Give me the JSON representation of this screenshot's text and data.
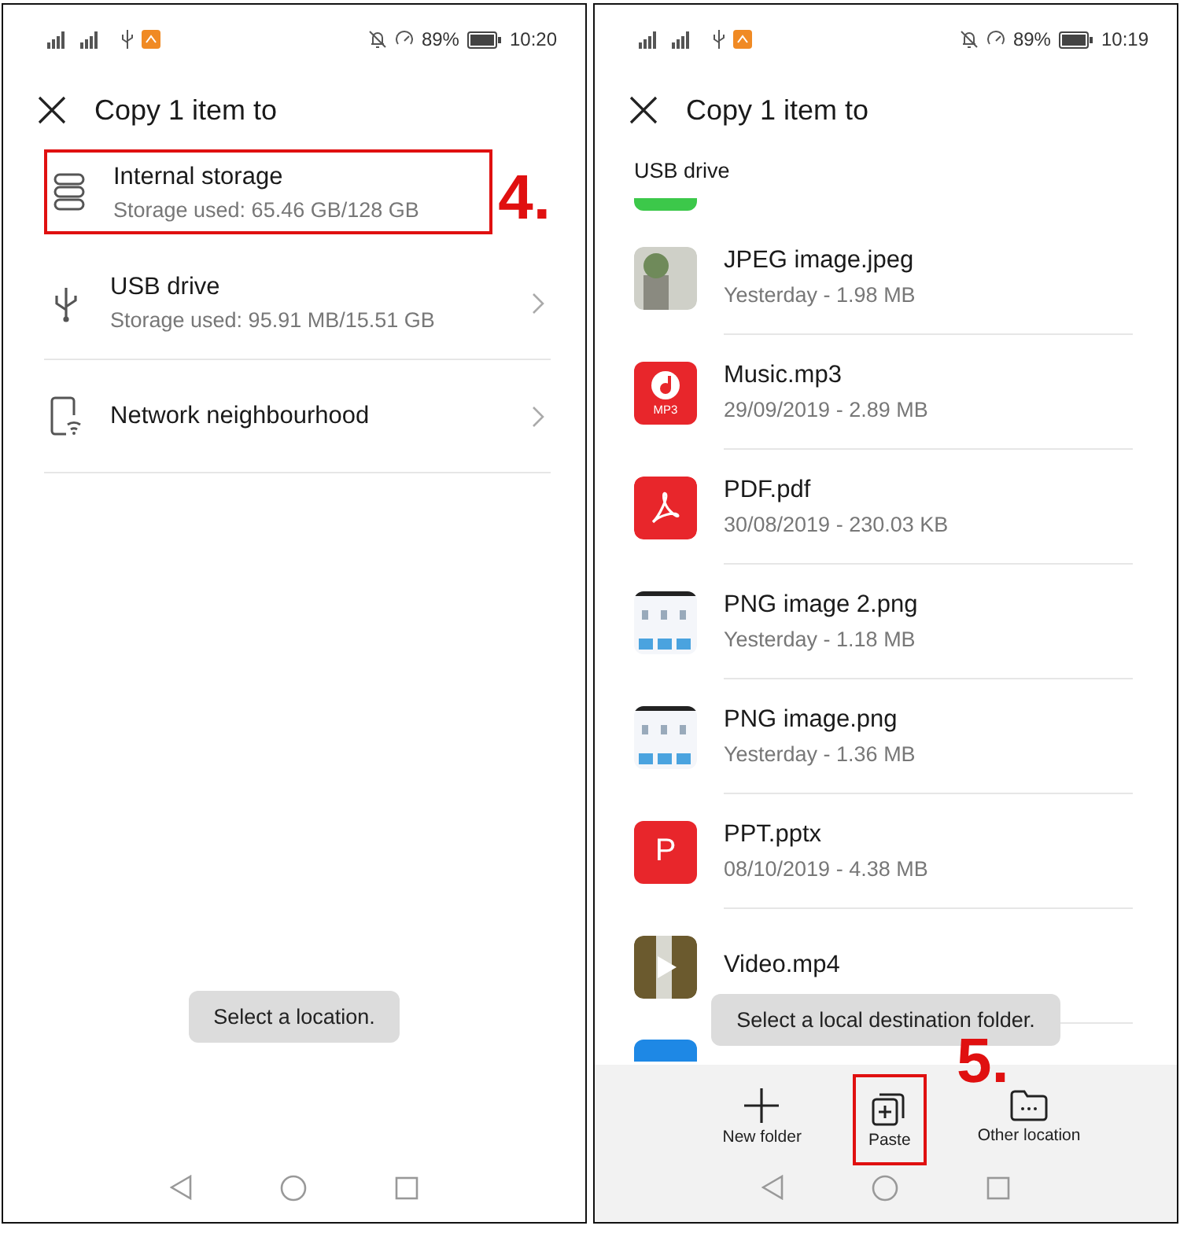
{
  "screens": [
    {
      "status_bar": {
        "battery": "89%",
        "time": "10:20"
      },
      "title": "Copy 1 item to",
      "locations": [
        {
          "kind": "internal",
          "name": "Internal storage",
          "detail": "Storage used: 65.46 GB/128 GB",
          "chevron": false,
          "annotation": "4."
        },
        {
          "kind": "usb",
          "name": "USB drive",
          "detail": "Storage used: 95.91 MB/15.51 GB",
          "chevron": true
        },
        {
          "kind": "network",
          "name": "Network neighbourhood",
          "chevron": true
        }
      ],
      "toast": "Select a location."
    },
    {
      "status_bar": {
        "battery": "89%",
        "time": "10:19"
      },
      "title": "Copy 1 item to",
      "breadcrumb": "USB drive",
      "files": [
        {
          "kind": "partial-top",
          "color": "#3cc84a"
        },
        {
          "kind": "photo",
          "name": "JPEG image.jpeg",
          "detail": "Yesterday - 1.98 MB"
        },
        {
          "kind": "music",
          "name": "Music.mp3",
          "detail": "29/09/2019 - 2.89 MB",
          "icon_text": "MP3",
          "color": "#e8262b"
        },
        {
          "kind": "pdf",
          "name": "PDF.pdf",
          "detail": "30/08/2019 - 230.03 KB",
          "color": "#e8262b"
        },
        {
          "kind": "screenshot",
          "name": "PNG image 2.png",
          "detail": "Yesterday - 1.18 MB"
        },
        {
          "kind": "screenshot",
          "name": "PNG image.png",
          "detail": "Yesterday - 1.36 MB"
        },
        {
          "kind": "letter",
          "name": "PPT.pptx",
          "detail": "08/10/2019 - 4.38 MB",
          "icon_text": "P",
          "color": "#e8262b"
        },
        {
          "kind": "video",
          "name": "Video.mp4"
        },
        {
          "kind": "partial-bottom",
          "color": "#1e88e5"
        }
      ],
      "toast": "Select a local destination folder.",
      "toolbar": [
        {
          "kind": "new-folder",
          "label": "New folder"
        },
        {
          "kind": "paste",
          "label": "Paste",
          "annotation": "5."
        },
        {
          "kind": "other",
          "label": "Other location"
        }
      ]
    }
  ]
}
